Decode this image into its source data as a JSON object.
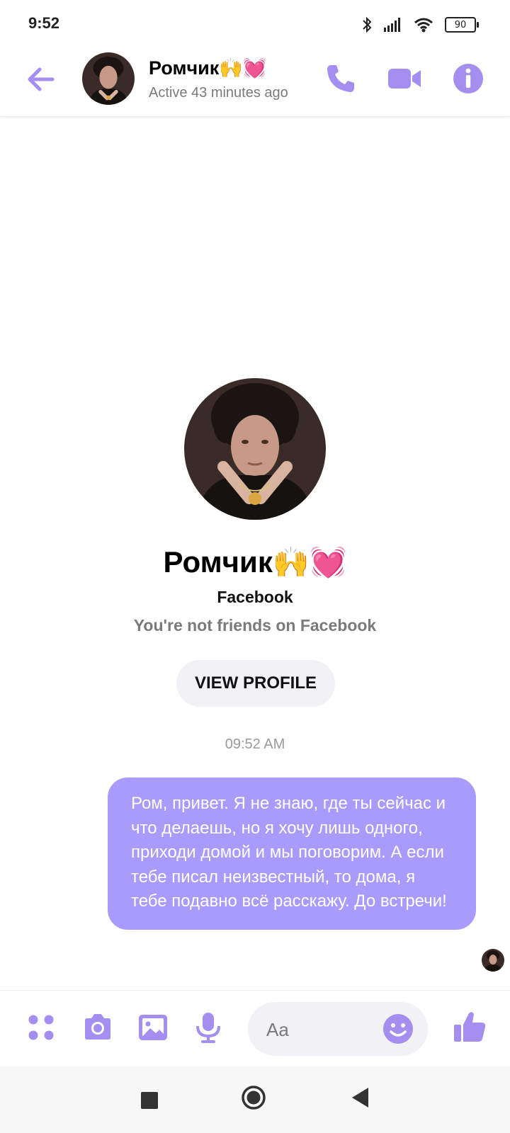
{
  "status_bar": {
    "time": "9:52",
    "battery": "90",
    "icons": [
      "bluetooth-icon",
      "signal-icon",
      "wifi-icon",
      "battery-icon"
    ]
  },
  "header": {
    "contact_name": "Ромчик🙌💓",
    "active_status": "Active 43 minutes ago",
    "icons": [
      "back-arrow-icon",
      "phone-icon",
      "video-icon",
      "info-icon"
    ]
  },
  "profile": {
    "name": "Ромчик🙌💓",
    "source": "Facebook",
    "friend_status": "You're not friends on Facebook",
    "view_profile_label": "VIEW PROFILE"
  },
  "conversation": {
    "timestamp": "09:52 AM",
    "messages": [
      {
        "sender": "me",
        "text": "Ром, привет. Я не знаю, где ты сейчас и что делаешь, но я хочу лишь одного, приходи домой и мы поговорим. А если тебе писал неизвестный, то дома, я тебе подавно всё расскажу. До встречи!"
      }
    ]
  },
  "composer": {
    "placeholder": "Aa",
    "icons": [
      "menu-dots-icon",
      "camera-icon",
      "gallery-icon",
      "microphone-icon",
      "emoji-icon",
      "thumbs-up-icon"
    ]
  },
  "colors": {
    "accent": "#a99bfb",
    "icon": "#a48ff0",
    "muted_text": "#7a7a7a"
  }
}
